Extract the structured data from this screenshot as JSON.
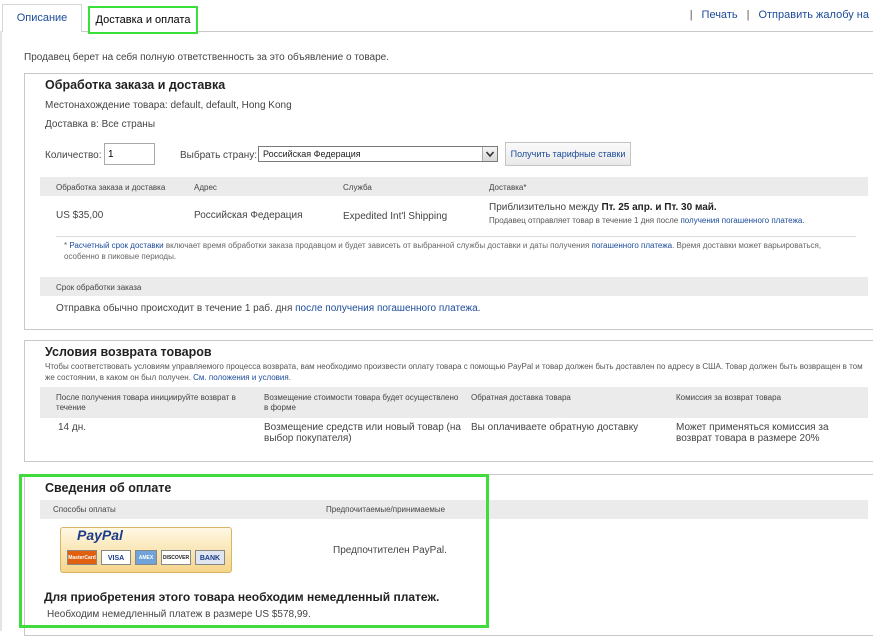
{
  "tabs": {
    "description": "Описание",
    "shipping": "Доставка и оплата"
  },
  "top_links": {
    "sep1": "|",
    "print": "Печать",
    "sep2": "|",
    "report": "Отправить жалобу на"
  },
  "seller_note": "Продавец берет на себя полную ответственность за это объявление о товаре.",
  "shipping": {
    "title": "Обработка заказа и доставка",
    "location": "Местонахождение товара: default, default, Hong Kong",
    "ships_to": "Доставка в: Все страны",
    "qty_label": "Количество:",
    "qty_value": "1",
    "country_label": "Выбрать страну:",
    "country_value": "Российская Федерация",
    "rates_button": "Получить тарифные ставки",
    "headers": [
      "Обработка заказа и доставка",
      "Адрес",
      "Служба",
      "Доставка*"
    ],
    "row": {
      "price": "US $35,00",
      "address": "Российская Федерация",
      "service": "Expedited Int'l Shipping",
      "delivery_prefix": "Приблизительно между ",
      "delivery_dates": "Пт. 25 апр. и Пт. 30 май.",
      "delivery_note_prefix": "Продавец отправляет товар в течение 1 дня после ",
      "delivery_note_link": "получения погашенного платежа."
    },
    "footnote_star": "* ",
    "footnote_link1": "Расчетный срок доставки",
    "footnote_mid": " включает время обработки заказа продавцом и будет зависеть от выбранной службы доставки и даты получения ",
    "footnote_link2": "погашенного платежа",
    "footnote_end": ". Время доставки может варьироваться, особенно в пиковые периоды.",
    "handling_header": "Срок обработки заказа",
    "handling_prefix": "Отправка обычно происходит в течение 1 раб. дня ",
    "handling_link": "после получения погашенного платежа",
    "handling_end": "."
  },
  "returns": {
    "title": "Условия возврата товаров",
    "text": "Чтобы соответствовать условиям управляемого процесса возврата, вам необходимо произвести оплату товара с помощью PayPal и товар должен быть доставлен по адресу в США. Товар должен быть возвращен в том же состоянии, в каком он был получен. ",
    "text_link": "См. положения и условия",
    "text_end": ".",
    "headers": [
      "После получения товара инициируйте возврат в течение",
      "Возмещение стоимости товара будет осуществлено в форме",
      "Обратная доставка товара",
      "Комиссия за возврат товара"
    ],
    "row": [
      "14 дн.",
      "Возмещение средств или новый товар (на выбор покупателя)",
      "Вы оплачиваете обратную доставку",
      "Может применяться комиссия за возврат товара в размере 20%"
    ]
  },
  "payment": {
    "title": "Сведения об оплате",
    "headers": [
      "Способы оплаты",
      "Предпочитаемые/принимаемые"
    ],
    "paypal_logo": "PayPal",
    "cards": [
      "MasterCard",
      "VISA",
      "AMEX",
      "DISCOVER",
      "BANK"
    ],
    "preferred": "Предпочтителен PayPal.",
    "immediate_title": "Для приобретения этого товара необходим немедленный платеж.",
    "immediate_text": "Необходим немедленный платеж в размере US $578,99."
  }
}
